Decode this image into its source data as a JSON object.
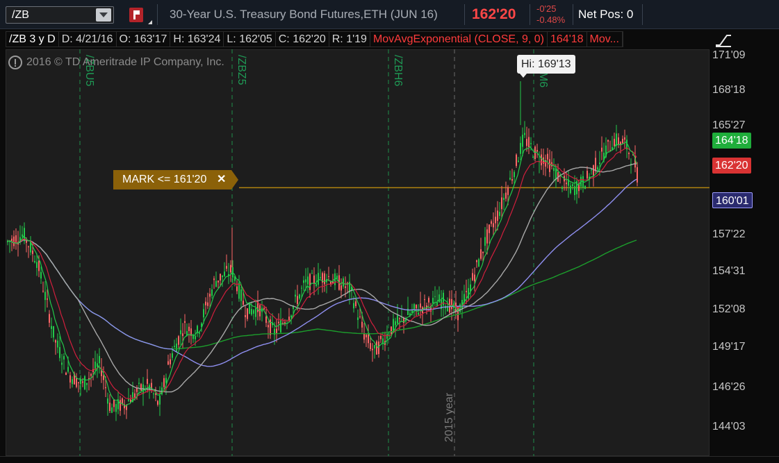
{
  "toolbar": {
    "symbol": "/ZB",
    "description": "30-Year U.S. Treasury Bond Futures,ETH (JUN 16)",
    "last_price": "162'20",
    "net_change": "-0'25",
    "percent_change": "-0.48%",
    "net_position": "Net Pos: 0"
  },
  "header": {
    "cells": [
      "/ZB 3 y D",
      "D: 4/21/16",
      "O: 163'17",
      "H: 163'24",
      "L: 162'05",
      "C: 162'20",
      "R: 1'19"
    ],
    "study": "MovAvgExponential (CLOSE, 9, 0)",
    "study_value": "164'18",
    "study_more": "Mov..."
  },
  "chart": {
    "copyright": "2016 © TD Ameritrade IP Company, Inc.",
    "hi_tooltip": "Hi: 169'13",
    "mark_label": "MARK <= 161'20",
    "mark_close": "✕",
    "year_label": "2015 year",
    "contract_labels": [
      "/ZBU5",
      "/ZBZ5",
      "/ZBH6",
      "/ZBM6"
    ],
    "price_axis": [
      "171'09",
      "168'18",
      "165'27",
      "157'22",
      "154'31",
      "152'08",
      "149'17",
      "146'26",
      "144'03"
    ],
    "axis_tags": [
      {
        "label": "164'18",
        "color": "#1fae3b",
        "value": 164.5625
      },
      {
        "label": "162'20",
        "color": "#d93333",
        "value": 162.625
      },
      {
        "label": "160'01",
        "color": "#b9b9ff",
        "value": 160.03
      }
    ],
    "colors": {
      "up": "#22c94a",
      "down": "#ff6666",
      "ema_fast": "#22c94a",
      "ema_mid": "#d11f3d",
      "sma_grey": "#a8a8a8",
      "sma_blue": "#8f8ff0",
      "sma_green": "#1c9e2c",
      "mark_line": "#b0830f"
    },
    "icons": [
      "info-icon",
      "drawing-tool-icon",
      "close-icon",
      "flag-icon",
      "dropdown-arrow-icon"
    ]
  }
}
